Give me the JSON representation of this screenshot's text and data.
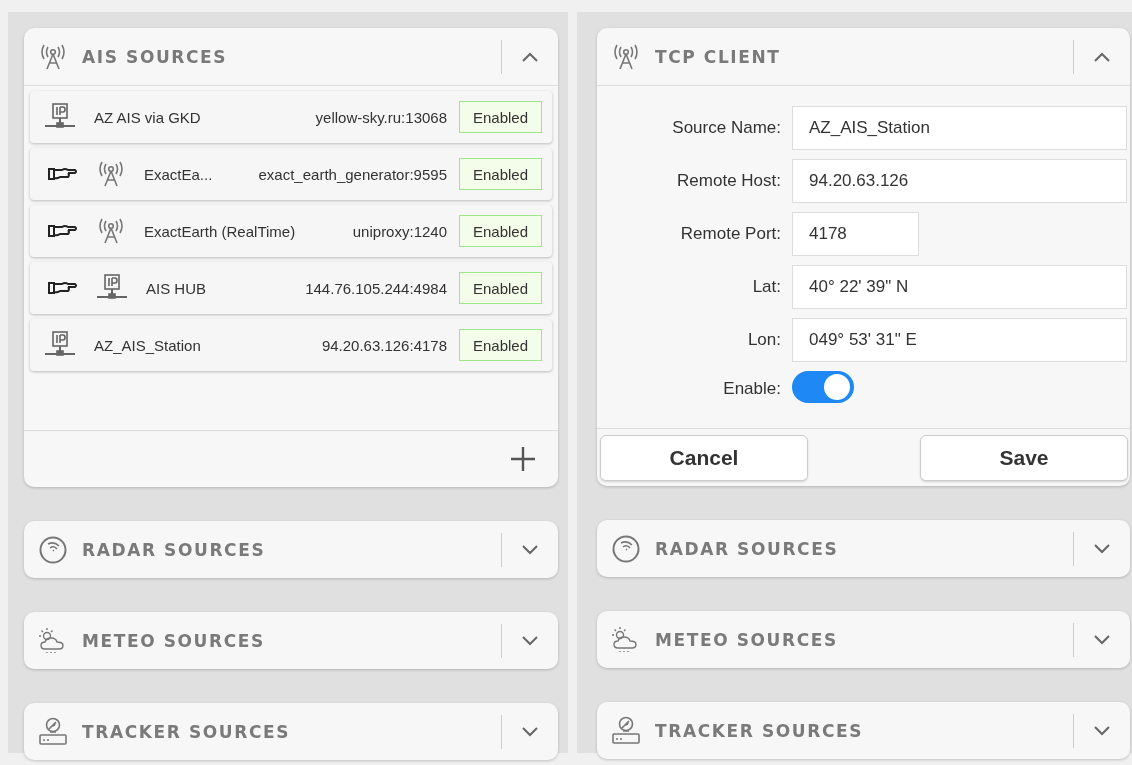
{
  "panels": [
    {
      "sections": [
        {
          "kind": "antenna",
          "title": "AIS SOURCES",
          "expanded": true,
          "sources": [
            {
              "name": "AZ AIS via GKD",
              "address": "yellow-sky.ru:13068",
              "status": "Enabled",
              "forwarded": false,
              "kind": "ip"
            },
            {
              "name": "ExactEa...",
              "address": "exact_earth_generator:9595",
              "status": "Enabled",
              "forwarded": true,
              "kind": "antenna"
            },
            {
              "name": "ExactEarth (RealTime)",
              "address": "uniproxy:1240",
              "status": "Enabled",
              "forwarded": true,
              "kind": "antenna"
            },
            {
              "name": "AIS HUB",
              "address": "144.76.105.244:4984",
              "status": "Enabled",
              "forwarded": true,
              "kind": "ip"
            },
            {
              "name": "AZ_AIS_Station",
              "address": "94.20.63.126:4178",
              "status": "Enabled",
              "forwarded": false,
              "kind": "ip"
            }
          ]
        },
        {
          "kind": "radar",
          "title": "RADAR SOURCES",
          "expanded": false
        },
        {
          "kind": "meteo",
          "title": "METEO SOURCES",
          "expanded": false
        },
        {
          "kind": "tracker",
          "title": "TRACKER SOURCES",
          "expanded": false
        }
      ]
    },
    {
      "sections": [
        {
          "kind": "antenna",
          "title": "TCP CLIENT",
          "expanded": true,
          "fields": [
            {
              "label": "Source Name:",
              "value": "AZ_AIS_Station",
              "kind": "wide"
            },
            {
              "label": "Remote Host:",
              "value": "94.20.63.126",
              "kind": "wide"
            },
            {
              "label": "Remote Port:",
              "value": "4178",
              "kind": "short"
            },
            {
              "label": "Lat:",
              "value": "40° 22' 39\" N",
              "kind": "wide"
            },
            {
              "label": "Lon:",
              "value": "049° 53' 31\" E",
              "kind": "wide"
            }
          ],
          "toggle": {
            "label": "Enable:",
            "on": true
          },
          "buttons": [
            "Cancel",
            "Save"
          ]
        },
        {
          "kind": "radar",
          "title": "RADAR SOURCES",
          "expanded": false
        },
        {
          "kind": "meteo",
          "title": "METEO SOURCES",
          "expanded": false
        },
        {
          "kind": "tracker",
          "title": "TRACKER SOURCES",
          "expanded": false
        }
      ]
    }
  ]
}
